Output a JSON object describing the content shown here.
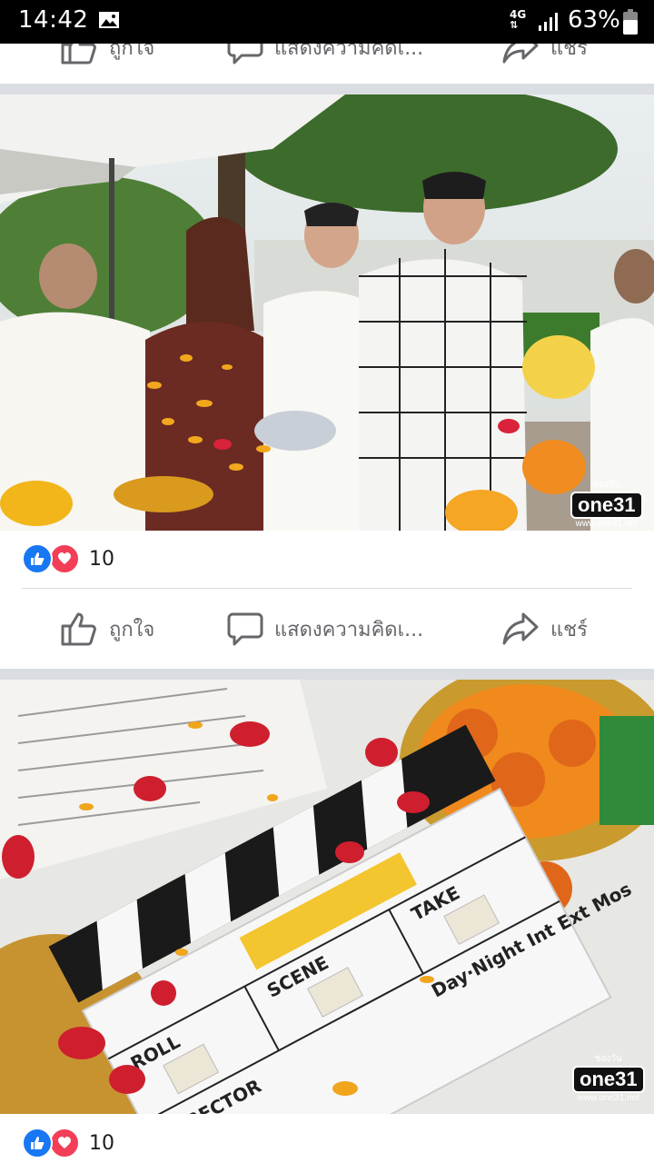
{
  "status_bar": {
    "time": "14:42",
    "network": "4G",
    "battery": "63%"
  },
  "actions": {
    "like": "ถูกใจ",
    "comment": "แสดงความคิดเ...",
    "share": "แชร์"
  },
  "posts": [
    {
      "reaction_count": "10",
      "watermark_channel": "ช่องวัน",
      "watermark_logo": "one31",
      "watermark_url": "www.one31.net"
    },
    {
      "reaction_count": "10",
      "watermark_channel": "ช่องวัน",
      "watermark_logo": "one31",
      "watermark_url": "www.one31.net"
    }
  ],
  "colors": {
    "action_gray": "#65676b",
    "like_blue": "#1877f2",
    "love_red": "#f33e58",
    "separator": "#dadde1"
  }
}
